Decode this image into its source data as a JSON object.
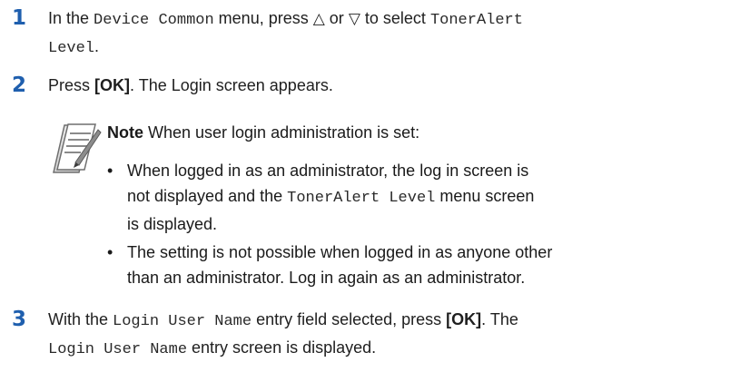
{
  "steps": [
    {
      "number": "1",
      "pre": "In the ",
      "menu": "Device Common",
      "mid": " menu, press ",
      "up_symbol": "△",
      "or_text": " or ",
      "down_symbol": "▽",
      "post": " to select ",
      "item_line1": "TonerAlert",
      "item_line2": "Level",
      "end": "."
    },
    {
      "number": "2",
      "pre": "Press ",
      "key": "[OK]",
      "post": ". The Login screen appears."
    },
    {
      "number": "3",
      "pre": "With the ",
      "field": "Login User Name",
      "mid": " entry field selected, press ",
      "key": "[OK]",
      "post": ". The",
      "line2_mono": "Login User Name",
      "line2_post": " entry screen is displayed."
    }
  ],
  "note": {
    "icon": "note-pad-icon",
    "label": "Note",
    "intro": "  When user login administration is set:",
    "bullet_symbol": "•",
    "bullet1_line1": "When logged in as an administrator, the log in screen is",
    "bullet1_line2_pre": "not displayed and the ",
    "bullet1_line2_mono": "TonerAlert Level",
    "bullet1_line2_post": " menu screen",
    "bullet1_line3": "is displayed.",
    "bullet2_line1": "The setting is not possible when logged in as anyone other",
    "bullet2_line2": "than an administrator. Log in again as an administrator."
  },
  "colors": {
    "step_number": "#1f5fae",
    "text": "#1f1f1f"
  }
}
